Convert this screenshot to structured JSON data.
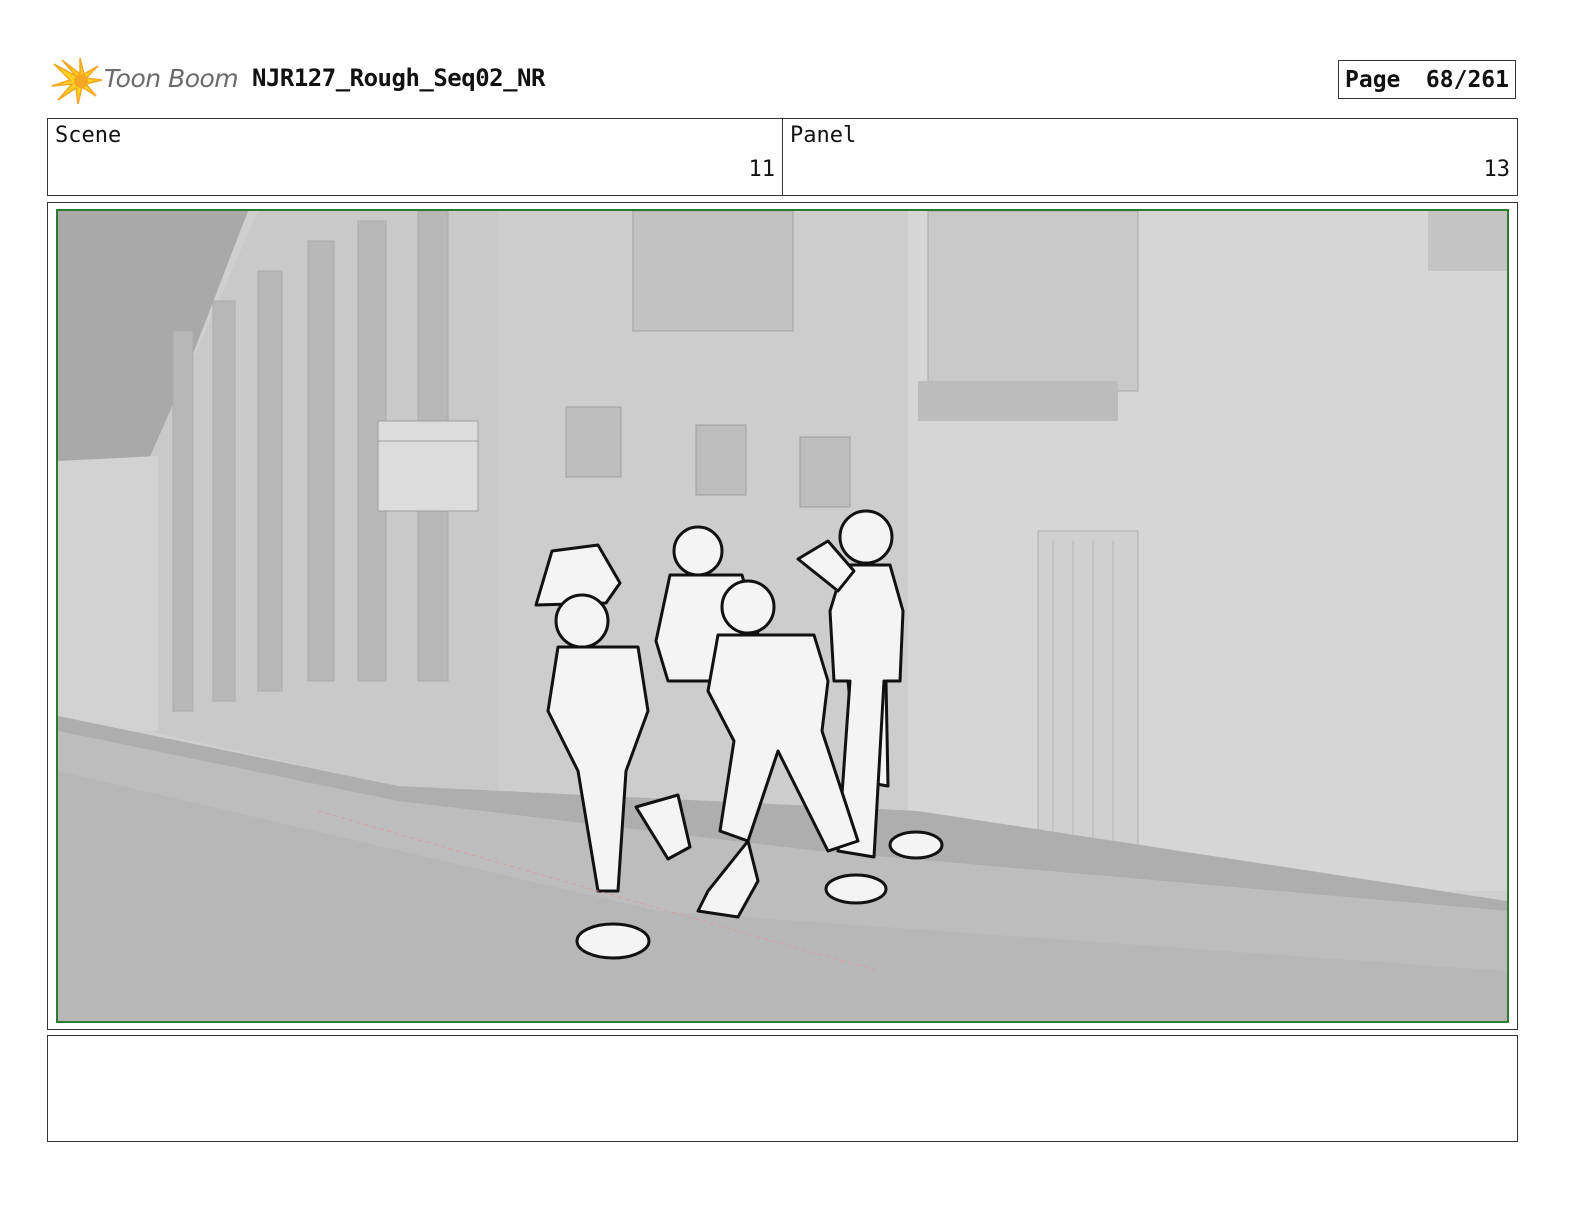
{
  "header": {
    "logo_text": "Toon Boom",
    "doc_title": "NJR127_Rough_Seq02_NR",
    "page_label": "Page",
    "page_value": "68/261"
  },
  "info": {
    "scene_label": "Scene",
    "scene_value": "11",
    "panel_label": "Panel",
    "panel_value": "13"
  },
  "panel": {
    "description": "",
    "frame_color": "#2f7a2f"
  },
  "notes": {
    "text": ""
  },
  "colors": {
    "logo_orange": "#f5a623",
    "logo_yellow": "#ffd21f",
    "logo_text": "#6b6b6b"
  }
}
